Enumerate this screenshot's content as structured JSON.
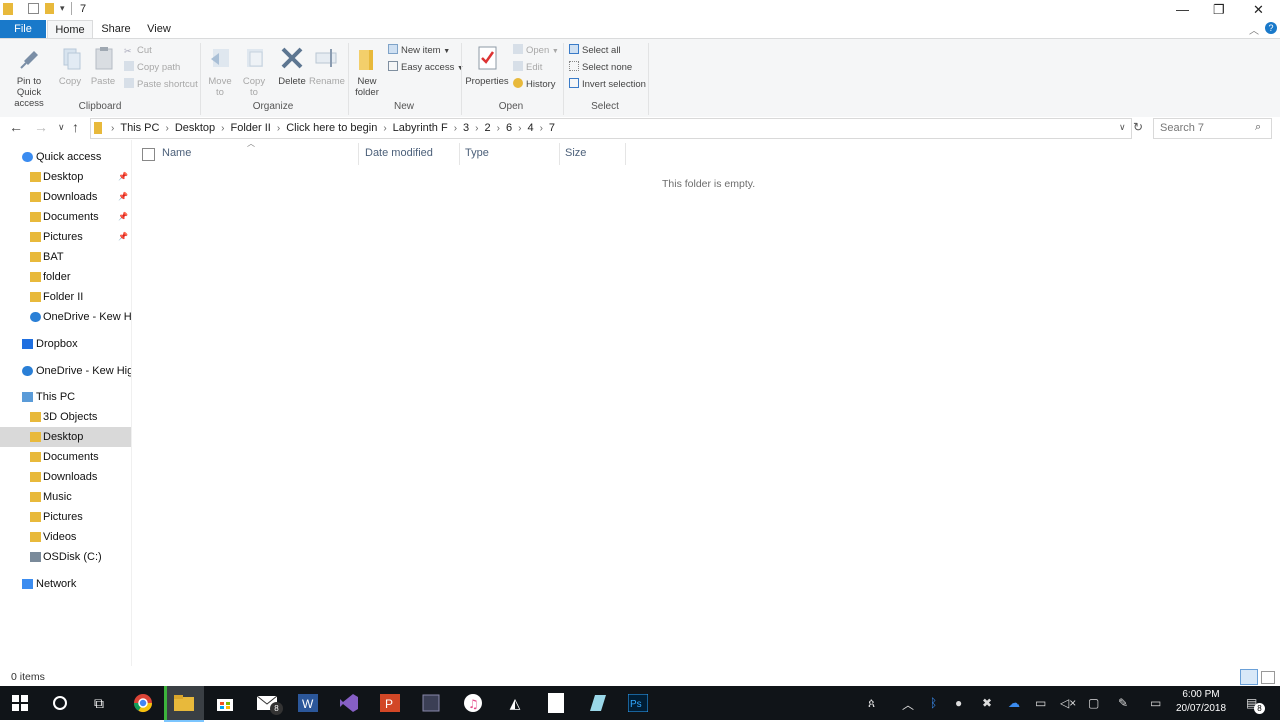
{
  "window": {
    "title": "7",
    "controls": {
      "minimize": "—",
      "restore": "❐",
      "close": "✕"
    }
  },
  "tabs": [
    "File",
    "Home",
    "Share",
    "View"
  ],
  "ribbon": {
    "clipboard": {
      "label": "Clipboard",
      "pin": "Pin to Quick access",
      "copy": "Copy",
      "paste": "Paste",
      "cut": "Cut",
      "copy_path": "Copy path",
      "paste_shortcut": "Paste shortcut"
    },
    "organize": {
      "label": "Organize",
      "move_to": "Move to",
      "copy_to": "Copy to",
      "delete": "Delete",
      "rename": "Rename"
    },
    "new": {
      "label": "New",
      "new_folder": "New folder",
      "new_item": "New item",
      "easy_access": "Easy access"
    },
    "open": {
      "label": "Open",
      "properties": "Properties",
      "open": "Open",
      "edit": "Edit",
      "history": "History"
    },
    "select": {
      "label": "Select",
      "select_all": "Select all",
      "select_none": "Select none",
      "invert_selection": "Invert selection"
    }
  },
  "address": {
    "crumbs": [
      "This PC",
      "Desktop",
      "Folder II",
      "Click here to begin",
      "Labyrinth F",
      "3",
      "2",
      "6",
      "4",
      "7"
    ],
    "search_placeholder": "Search 7"
  },
  "nav": [
    {
      "label": "Quick access",
      "icon": "star-icon",
      "indent": 0
    },
    {
      "label": "Desktop",
      "icon": "folder-icon",
      "indent": 1,
      "pinned": true
    },
    {
      "label": "Downloads",
      "icon": "folder-icon",
      "indent": 1,
      "pinned": true
    },
    {
      "label": "Documents",
      "icon": "folder-icon",
      "indent": 1,
      "pinned": true
    },
    {
      "label": "Pictures",
      "icon": "folder-icon",
      "indent": 1,
      "pinned": true
    },
    {
      "label": "BAT",
      "icon": "folder-icon",
      "indent": 1
    },
    {
      "label": "folder",
      "icon": "folder-icon",
      "indent": 1
    },
    {
      "label": "Folder II",
      "icon": "folder-icon",
      "indent": 1
    },
    {
      "label": "OneDrive - Kew Hig",
      "icon": "cloud-icon",
      "indent": 1
    },
    {
      "label": "Dropbox",
      "icon": "dropbox-icon",
      "indent": 0
    },
    {
      "label": "OneDrive - Kew High",
      "icon": "cloud-icon",
      "indent": 0
    },
    {
      "label": "This PC",
      "icon": "computer-icon",
      "indent": 0
    },
    {
      "label": "3D Objects",
      "icon": "folder-icon",
      "indent": 1
    },
    {
      "label": "Desktop",
      "icon": "folder-icon",
      "indent": 1,
      "selected": true
    },
    {
      "label": "Documents",
      "icon": "folder-icon",
      "indent": 1
    },
    {
      "label": "Downloads",
      "icon": "folder-icon",
      "indent": 1
    },
    {
      "label": "Music",
      "icon": "folder-icon",
      "indent": 1
    },
    {
      "label": "Pictures",
      "icon": "folder-icon",
      "indent": 1
    },
    {
      "label": "Videos",
      "icon": "folder-icon",
      "indent": 1
    },
    {
      "label": "OSDisk (C:)",
      "icon": "drive-icon",
      "indent": 1
    },
    {
      "label": "Network",
      "icon": "network-icon",
      "indent": 0
    }
  ],
  "columns": [
    "Name",
    "Date modified",
    "Type",
    "Size"
  ],
  "empty_message": "This folder is empty.",
  "status": "0 items",
  "taskbar": {
    "time": "6:00 PM",
    "date": "20/07/2018",
    "mail_badge": "8",
    "notification_badge": "8"
  },
  "colors": {
    "accent": "#1979ca",
    "folder": "#e8b93b",
    "taskbar": "#101418"
  }
}
